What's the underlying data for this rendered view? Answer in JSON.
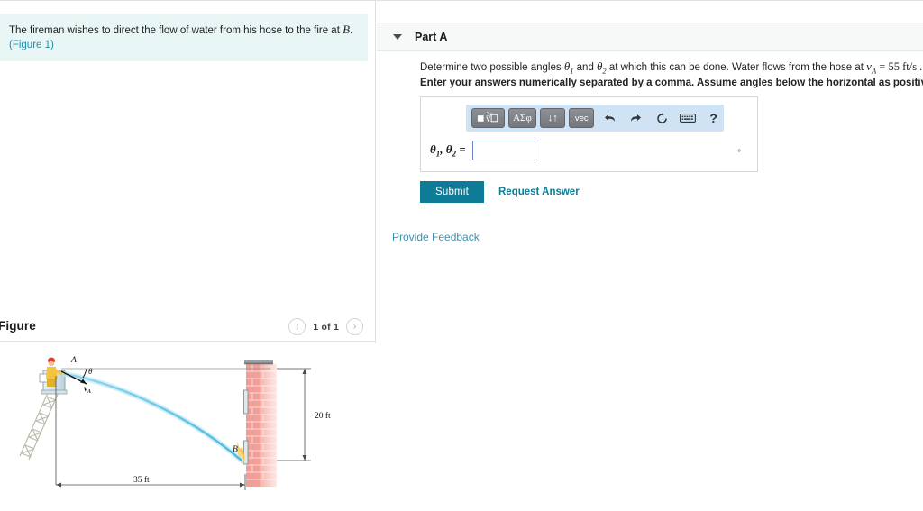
{
  "question": {
    "text_before": "The fireman wishes to direct the flow of water from his hose to the fire at ",
    "point_label": "B",
    "text_after": ".",
    "figure_link": "(Figure 1)"
  },
  "part": {
    "title": "Part A",
    "caret_icon": "chevron-down-icon",
    "prompt_line1_a": "Determine two possible angles ",
    "prompt_theta1": "θ",
    "prompt_sub1": "1",
    "prompt_line1_b": " and ",
    "prompt_theta2": "θ",
    "prompt_sub2": "2",
    "prompt_line1_c": " at which this can be done. Water flows from the hose at ",
    "prompt_v": "v",
    "prompt_v_sub": "A",
    "prompt_line1_d": " = 55 ft/s .",
    "prompt_line2": "Enter your answers numerically separated by a comma. Assume angles below the horizontal as positive."
  },
  "math_toolbar": {
    "buttons": [
      {
        "name": "template-root-button",
        "label": "■√□"
      },
      {
        "name": "greek-symbols-button",
        "label": "ΑΣφ"
      },
      {
        "name": "arrows-button",
        "label": "↓↑"
      },
      {
        "name": "vector-button",
        "label": "vec"
      }
    ],
    "icons": [
      {
        "name": "undo-icon",
        "glyph": "↶"
      },
      {
        "name": "redo-icon",
        "glyph": "↷"
      },
      {
        "name": "reset-icon",
        "glyph": "↻"
      },
      {
        "name": "keyboard-icon",
        "glyph": "⌨"
      },
      {
        "name": "help-icon",
        "glyph": "?"
      }
    ]
  },
  "answer": {
    "label_theta": "θ",
    "label_sub1": "1",
    "label_comma": ", ",
    "label_sub2": "2",
    "label_equals": " =",
    "value": "",
    "placeholder": "",
    "unit": "°"
  },
  "actions": {
    "submit_label": "Submit",
    "request_answer_label": "Request Answer",
    "provide_feedback_label": "Provide Feedback"
  },
  "figure": {
    "title": "Figure",
    "pager_prev": "‹",
    "pager_next": "›",
    "pager_count": "1 of 1",
    "labels": {
      "point_a": "A",
      "point_b": "B",
      "angle": "θ",
      "velocity": "v",
      "velocity_sub": "A",
      "height": "20 ft",
      "distance": "35 ft"
    }
  },
  "colors": {
    "accent_teal": "#0e7c96",
    "link_blue": "#3a92ad",
    "question_bg": "#e8f6f5",
    "toolbar_bg": "#cfe3f4",
    "input_border": "#6f86c4",
    "brick": "#f09a92",
    "water": "#5fc3e4",
    "flame": "#f5a623"
  }
}
